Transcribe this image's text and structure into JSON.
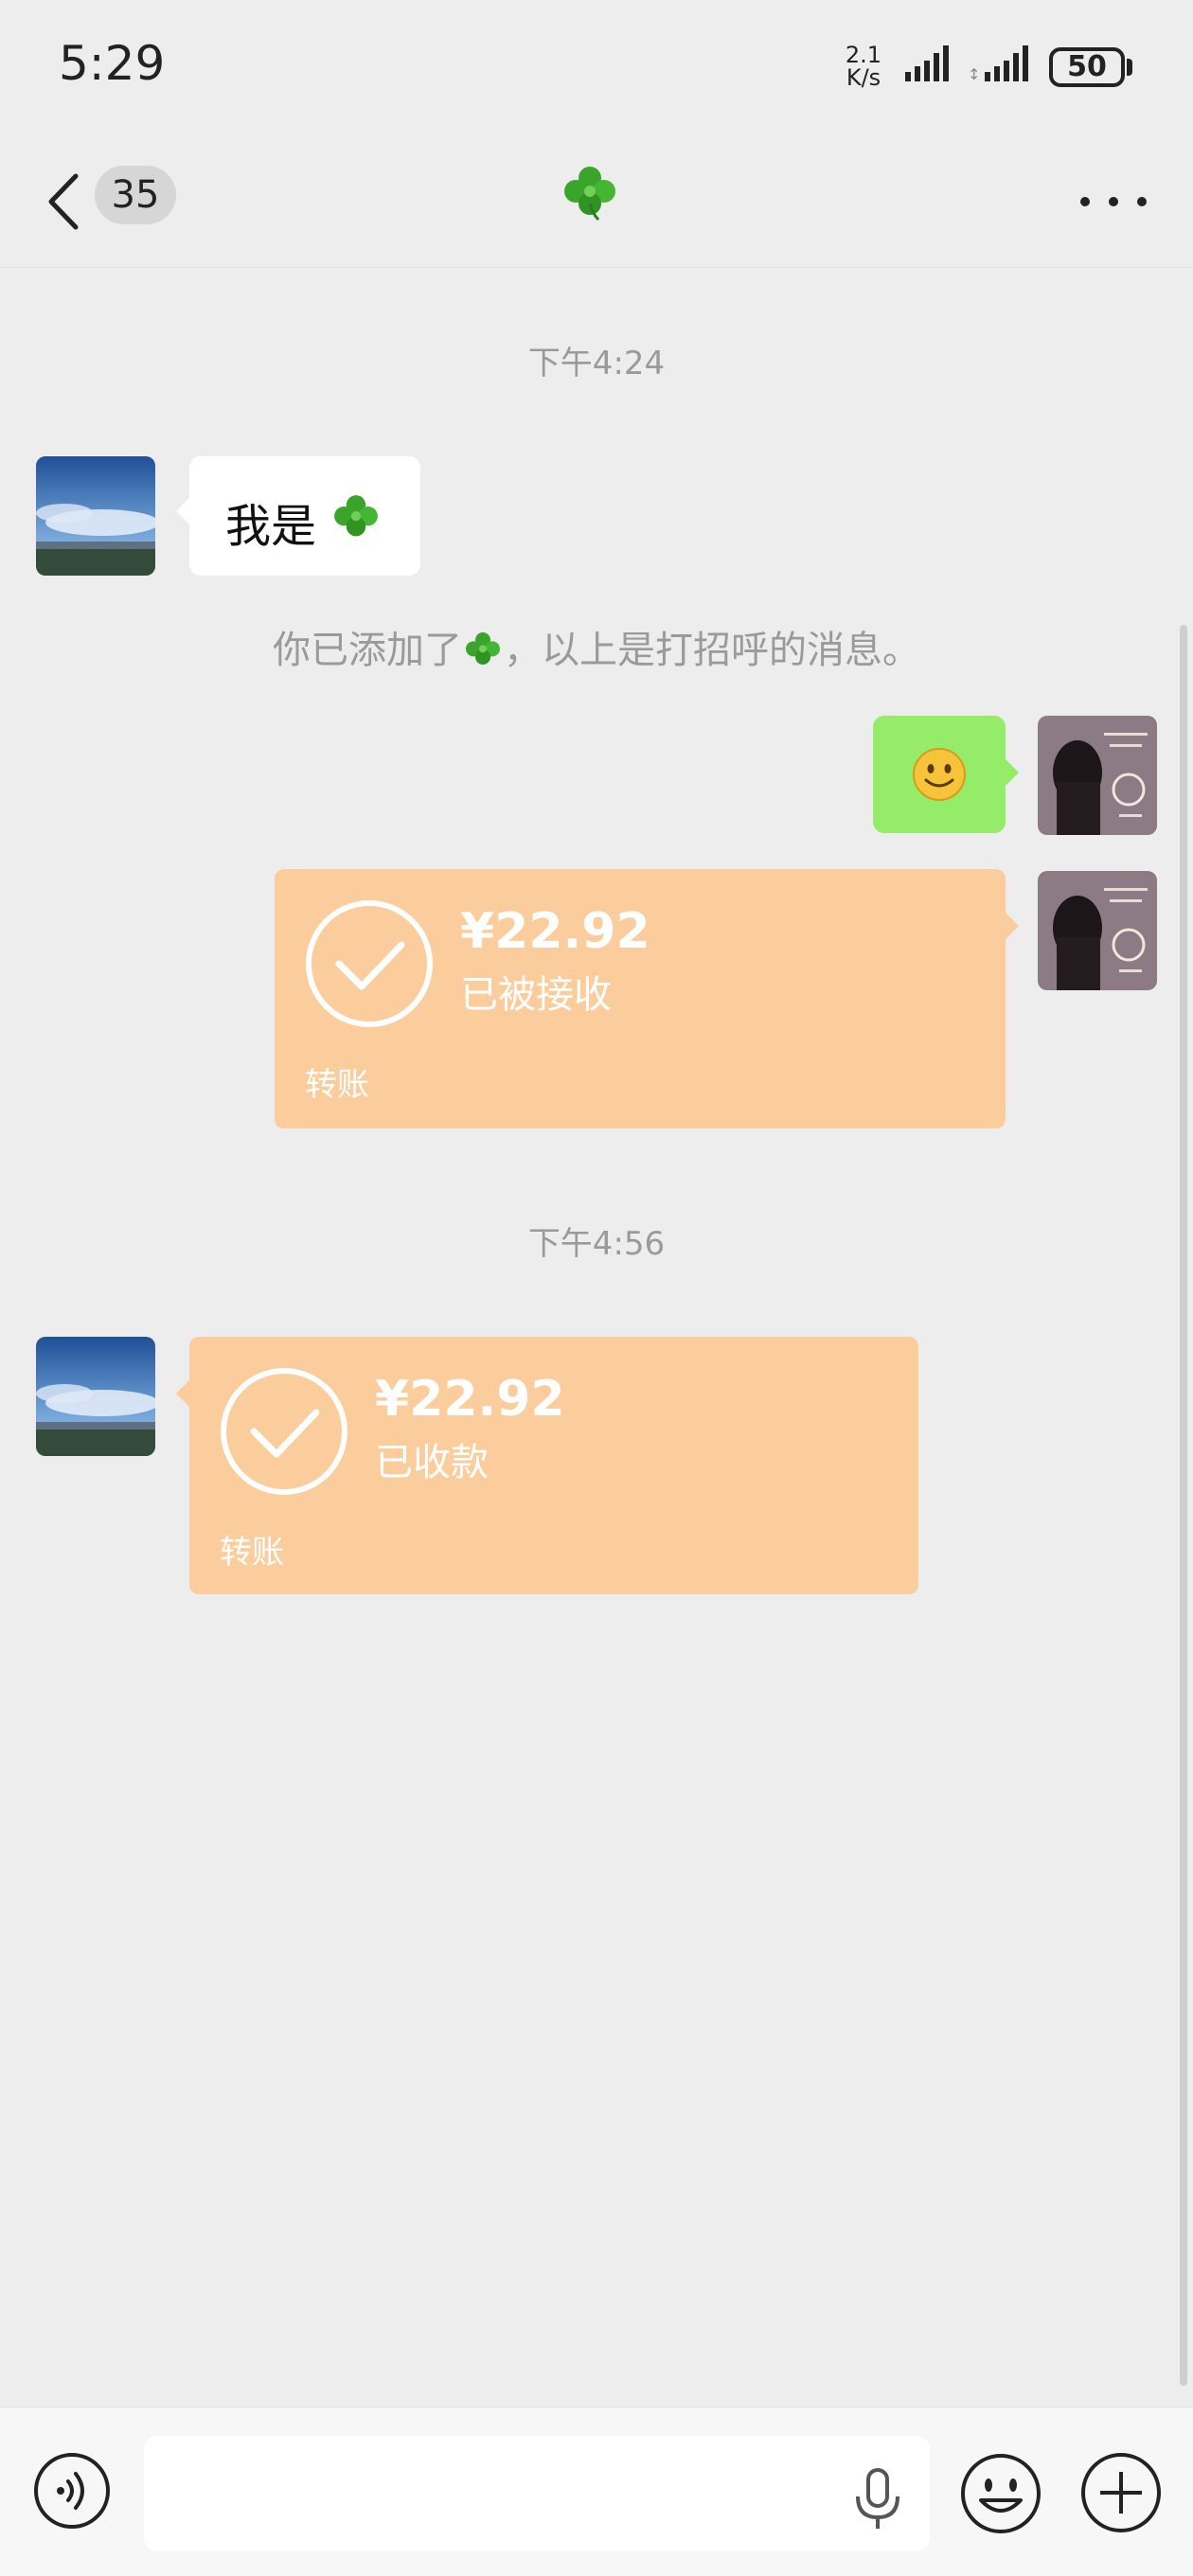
{
  "status_bar": {
    "time": "5:29",
    "net_speed_value": "2.1",
    "net_speed_unit": "K/s",
    "battery": "50"
  },
  "header": {
    "unread_count": "35",
    "title_icon": "four-leaf-clover-icon",
    "more_icon": "more-dots-icon"
  },
  "messages": {
    "timestamp_1": "下午4:24",
    "greeting": "我是",
    "system_notice_prefix": "你已添加了",
    "system_notice_suffix": "，以上是打招呼的消息。",
    "transfer_1": {
      "amount": "¥22.92",
      "status": "已被接收",
      "label": "转账"
    },
    "timestamp_2": "下午4:56",
    "transfer_2": {
      "amount": "¥22.92",
      "status": "已收款",
      "label": "转账"
    }
  },
  "input_bar": {
    "input_value": "",
    "voice_icon": "voice-icon",
    "mic_icon": "mic-icon",
    "emoji_icon": "emoji-icon",
    "plus_icon": "plus-icon"
  },
  "colors": {
    "background": "#ededed",
    "transfer_bubble": "#fbcd9c",
    "sent_bubble": "#95ec69"
  }
}
